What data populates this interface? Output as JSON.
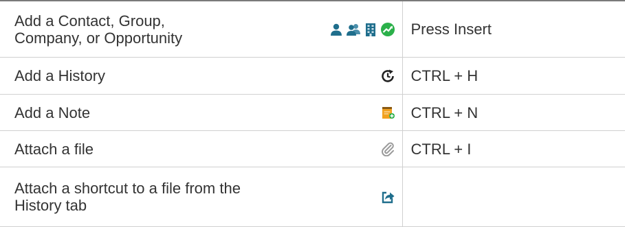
{
  "rows": [
    {
      "action_lines": [
        "Add a Contact, Group,",
        "Company, or Opportunity"
      ],
      "shortcut": "Press Insert",
      "icons": [
        "contact-icon",
        "group-icon",
        "company-icon",
        "opportunity-icon"
      ]
    },
    {
      "action_lines": [
        "Add a History"
      ],
      "shortcut": "CTRL + H",
      "icons": [
        "history-icon"
      ]
    },
    {
      "action_lines": [
        "Add a Note"
      ],
      "shortcut": "CTRL + N",
      "icons": [
        "note-icon"
      ]
    },
    {
      "action_lines": [
        "Attach a file"
      ],
      "shortcut": "CTRL + I",
      "icons": [
        "paperclip-icon"
      ]
    },
    {
      "action_lines": [
        "Attach a shortcut to a file from the",
        "History tab"
      ],
      "shortcut": "",
      "icons": [
        "share-arrow-icon"
      ]
    }
  ],
  "colors": {
    "icon_teal": "#1f6e8c",
    "icon_green": "#2bb04a",
    "note_orange": "#f2a11f",
    "text": "#333333"
  }
}
